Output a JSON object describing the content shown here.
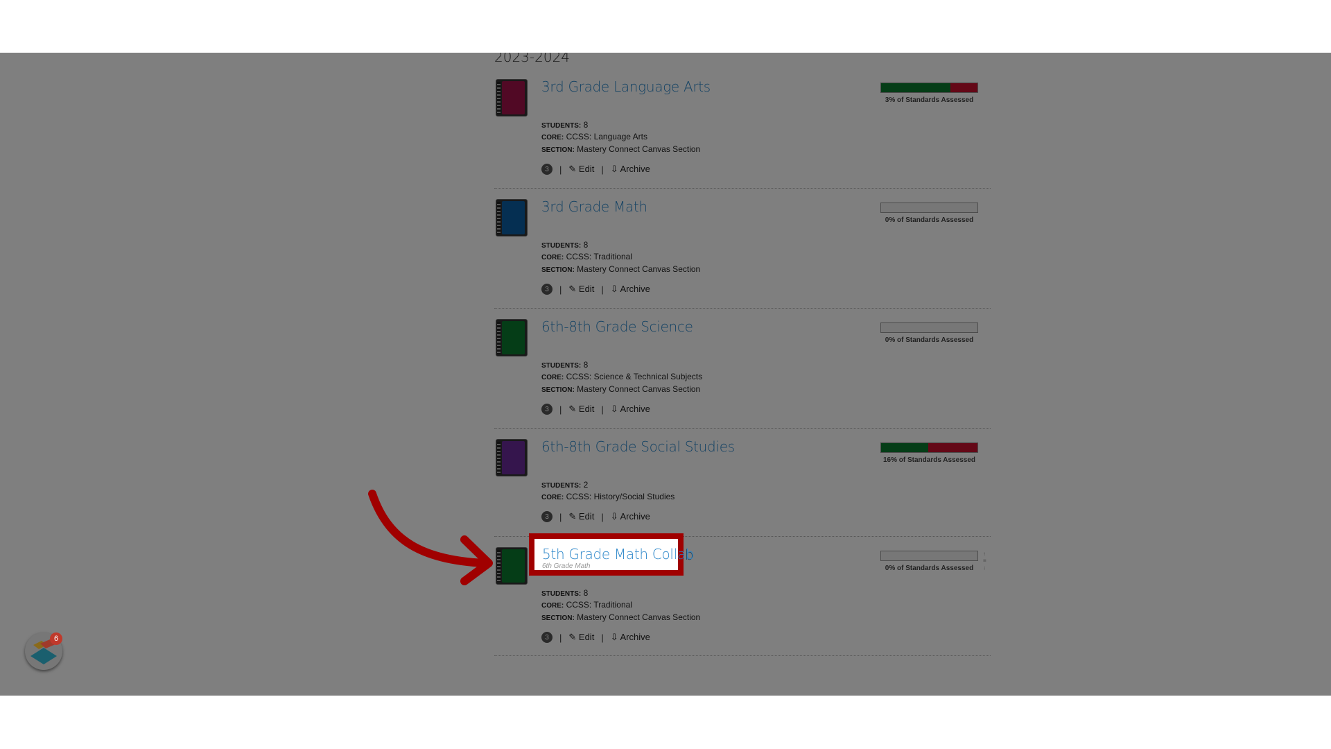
{
  "year": "2023-2024",
  "labels": {
    "students": "STUDENTS:",
    "core": "CORE:",
    "section": "SECTION:",
    "edit": "Edit",
    "archive": "Archive",
    "separator": "|"
  },
  "courses": [
    {
      "title": "3rd Grade Language Arts",
      "color": "#a3124a",
      "students": "8",
      "core": "CCSS: Language Arts",
      "section": "Mastery Connect Canvas Section",
      "badge": "3",
      "assessed": "3% of Standards Assessed",
      "bar_green_pct": 72,
      "bar_red_pct": 28
    },
    {
      "title": "3rd Grade Math",
      "color": "#0b5fa5",
      "students": "8",
      "core": "CCSS: Traditional",
      "section": "Mastery Connect Canvas Section",
      "badge": "3",
      "assessed": "0% of Standards Assessed",
      "bar_green_pct": 0,
      "bar_red_pct": 0
    },
    {
      "title": "6th-8th Grade Science",
      "color": "#0b7a2e",
      "students": "8",
      "core": "CCSS: Science & Technical Subjects",
      "section": "Mastery Connect Canvas Section",
      "badge": "3",
      "assessed": "0% of Standards Assessed",
      "bar_green_pct": 0,
      "bar_red_pct": 0
    },
    {
      "title": "6th-8th Grade Social Studies",
      "color": "#6a2a9b",
      "students": "2",
      "core": "CCSS: History/Social Studies",
      "badge": "3",
      "assessed": "16% of Standards Assessed",
      "bar_green_pct": 49,
      "bar_red_pct": 51
    },
    {
      "title": "5th Grade Math Collab",
      "subtitle": "6th Grade Math",
      "color": "#0b7a2e",
      "students": "8",
      "core": "CCSS: Traditional",
      "section": "Mastery Connect Canvas Section",
      "badge": "3",
      "assessed": "0% of Standards Assessed",
      "bar_green_pct": 0,
      "bar_red_pct": 0,
      "highlighted": true
    }
  ],
  "logo": {
    "badge": "6"
  },
  "colors": {
    "highlight": "#a00000",
    "link": "#2b86c9"
  }
}
